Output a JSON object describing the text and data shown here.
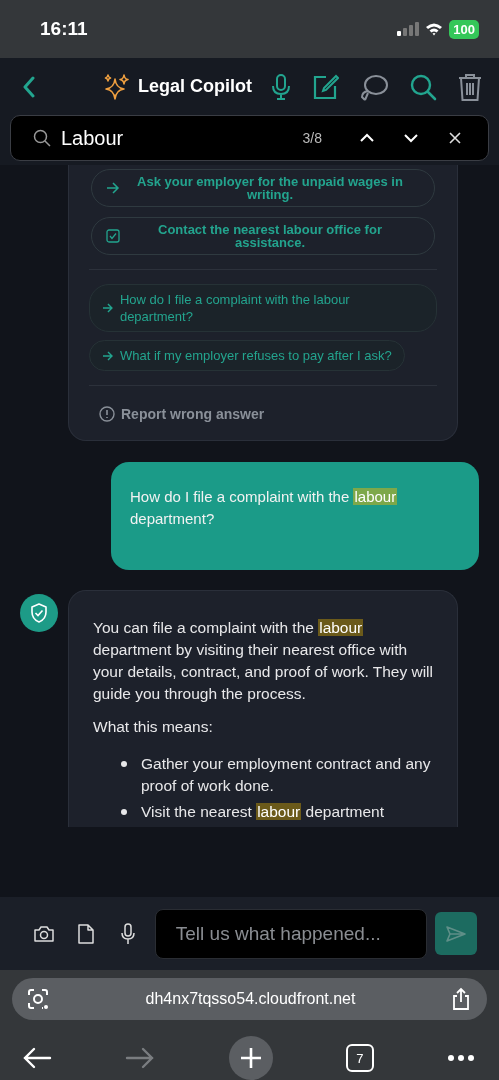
{
  "status_bar": {
    "time": "16:11",
    "battery": "100"
  },
  "header": {
    "title": "Legal Copilot"
  },
  "search": {
    "value": "Labour",
    "count": "3/8"
  },
  "answer_card": {
    "steps": [
      {
        "kind": "arrow",
        "text": "Ask your employer for the unpaid wages in writing."
      },
      {
        "kind": "checkbox",
        "checked": true,
        "text": "Contact the nearest labour office for assistance."
      }
    ],
    "suggestions": [
      {
        "text": "How do I file a complaint with the labour department?"
      },
      {
        "text": "What if my employer refuses to pay after I ask?"
      }
    ],
    "report": "Report wrong answer"
  },
  "user_message": {
    "segments": [
      {
        "text": "How do I file a complaint with the ",
        "highlighted": false
      },
      {
        "text": "labour",
        "highlighted": true
      },
      {
        "text": " department?",
        "highlighted": false
      }
    ]
  },
  "bot_message": {
    "paragraph": [
      {
        "text": "You can file a complaint with the ",
        "highlighted": false
      },
      {
        "text": "labour",
        "highlighted": true
      },
      {
        "text": " department by visiting their nearest office with your details, contract, and proof of work. They will guide you through the process.",
        "highlighted": false
      }
    ],
    "subheading": "What this means:",
    "bullets": [
      [
        {
          "text": "Gather your employment contract and any proof of work done.",
          "highlighted": false
        }
      ],
      [
        {
          "text": "Visit the nearest ",
          "highlighted": false
        },
        {
          "text": "labour",
          "highlighted": true
        },
        {
          "text": " department",
          "highlighted": false
        }
      ]
    ]
  },
  "composer": {
    "placeholder": "Tell us what happened..."
  },
  "browser": {
    "url": "dh4nx7tqsso54.cloudfront.net",
    "tab_count": "7",
    "forward_disabled": true
  }
}
